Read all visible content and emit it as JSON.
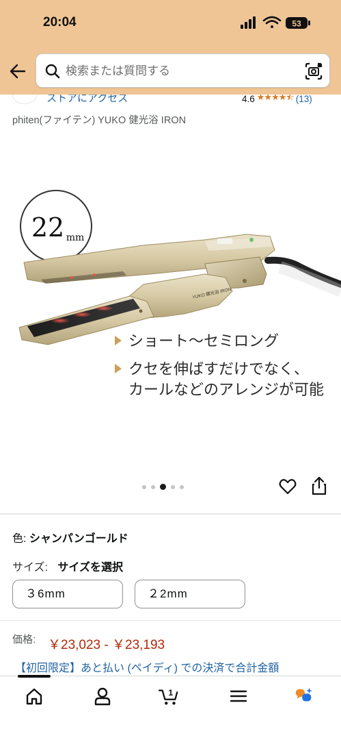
{
  "status_bar": {
    "time": "20:04",
    "battery": "53"
  },
  "search": {
    "placeholder": "検索または質問する"
  },
  "store": {
    "link": "ストアにアクセス",
    "rating": "4.6",
    "review_count": "(13)"
  },
  "product": {
    "title": "phiten(ファイテン) YUKO 健光浴 IRON",
    "image_text": {
      "size_badge_num": "22",
      "size_badge_unit": "mm",
      "device_label": "YUKO 健光浴 IRON",
      "bullet1": "ショート〜セミロング",
      "bullet2_line1": "クセを伸ばすだけでなく、",
      "bullet2_line2": "カールなどのアレンジが可能"
    },
    "carousel": {
      "count": 5,
      "active_index": 2
    }
  },
  "color": {
    "label": "色:",
    "value": "シャンパンゴールド"
  },
  "size": {
    "label": "サイズ:",
    "value": "サイズを選択",
    "options": [
      "３6mm",
      "２2mm"
    ]
  },
  "price": {
    "label": "価格:",
    "value": "￥23,023 - ￥23,193"
  },
  "promo": "【初回限定】あと払い (ペイディ) での決済で合計金額",
  "cart_count": "1",
  "colors": {
    "header": "#efc595",
    "link": "#2162a1",
    "price": "#b12704",
    "star": "#de7921"
  }
}
